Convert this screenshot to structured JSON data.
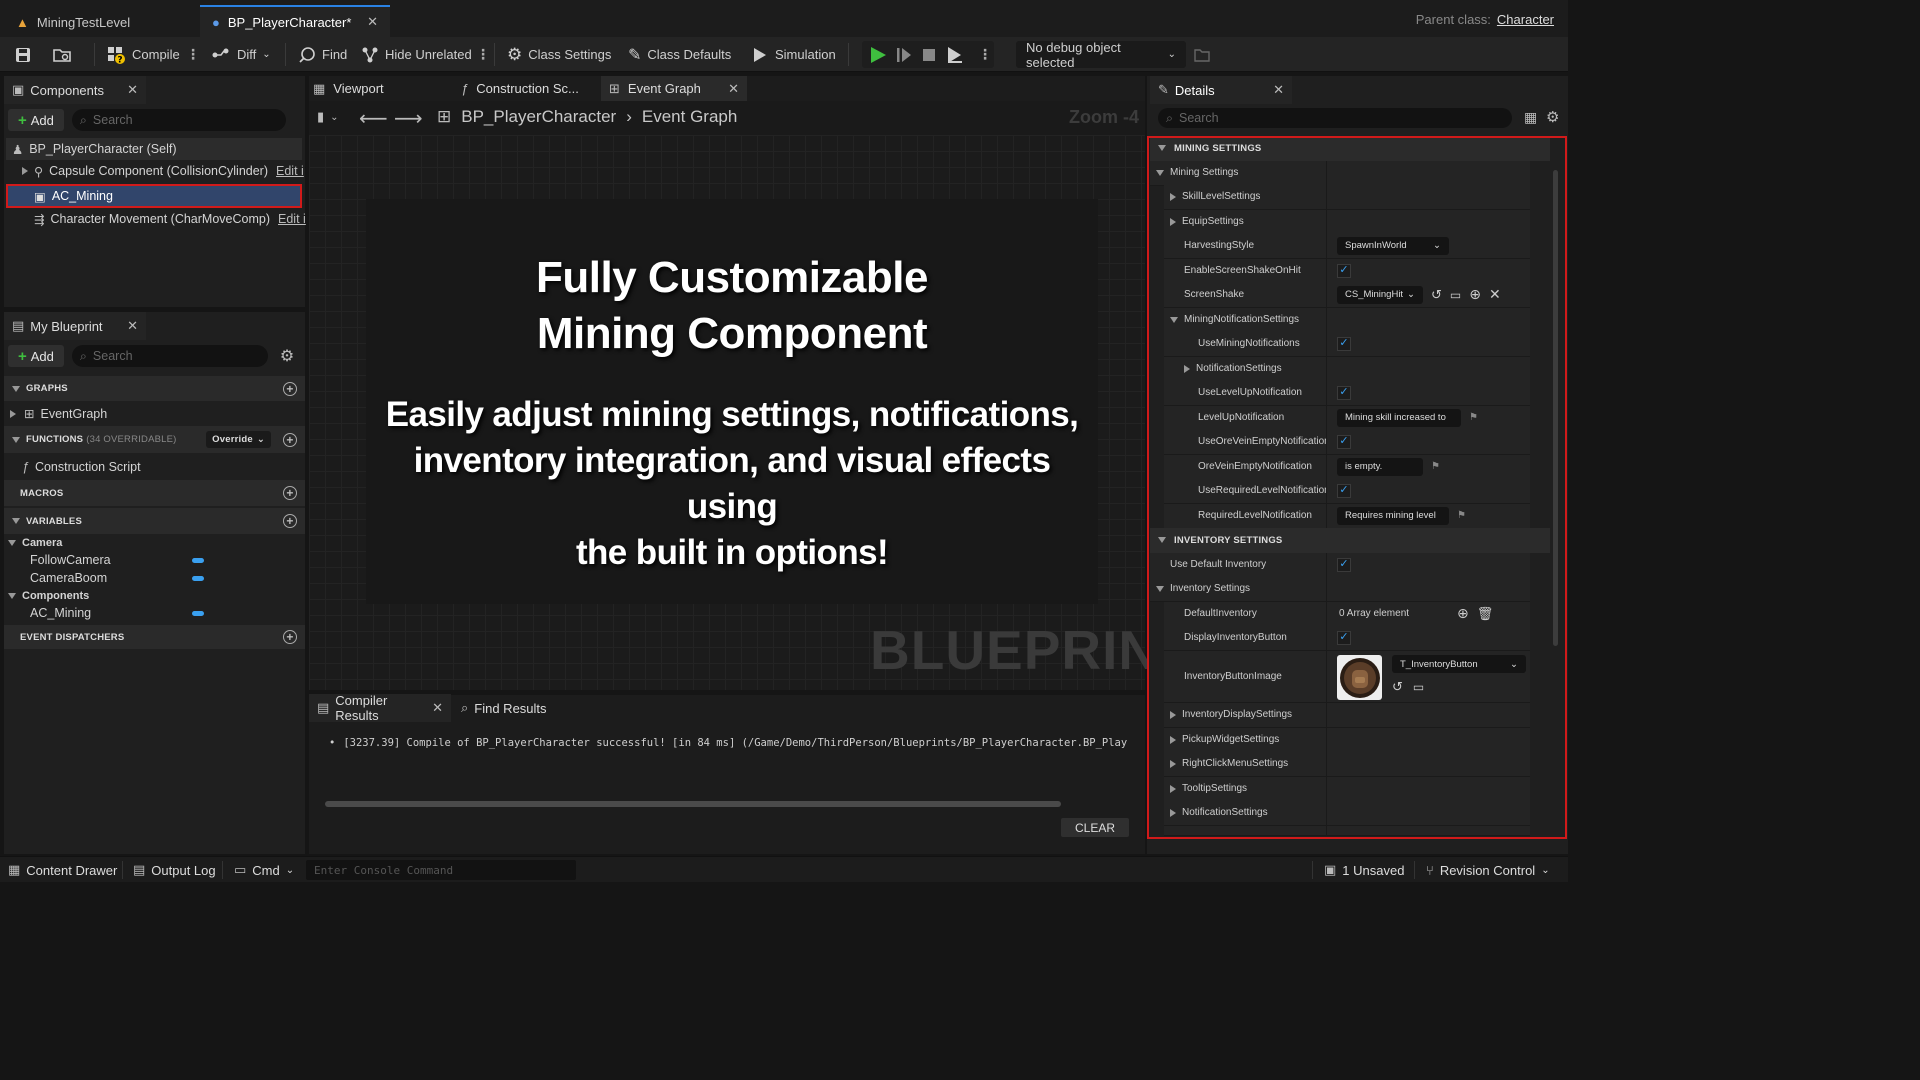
{
  "tabs": [
    {
      "label": "MiningTestLevel"
    },
    {
      "label": "BP_PlayerCharacter*"
    }
  ],
  "parent_class": {
    "label": "Parent class:",
    "value": "Character"
  },
  "toolbar": {
    "compile": "Compile",
    "diff": "Diff",
    "find": "Find",
    "hide_unrelated": "Hide Unrelated",
    "class_settings": "Class Settings",
    "class_defaults": "Class Defaults",
    "simulation": "Simulation",
    "debug_object": "No debug object selected"
  },
  "components": {
    "tab": "Components",
    "add": "Add",
    "search_placeholder": "Search",
    "items": [
      "BP_PlayerCharacter (Self)",
      "Capsule Component (CollisionCylinder)",
      "AC_Mining",
      "Character Movement (CharMoveComp)"
    ],
    "edit_label": "Edit i"
  },
  "my_blueprint": {
    "tab": "My Blueprint",
    "add": "Add",
    "search_placeholder": "Search",
    "graphs": "GRAPHS",
    "event_graph": "EventGraph",
    "functions": "FUNCTIONS",
    "functions_sub": "(34 OVERRIDABLE)",
    "override": "Override",
    "construction_script": "Construction Script",
    "macros": "MACROS",
    "variables": "VARIABLES",
    "cat_camera": "Camera",
    "var_follow": "FollowCamera",
    "var_boom": "CameraBoom",
    "cat_components": "Components",
    "var_mining": "AC_Mining",
    "event_dispatchers": "EVENT DISPATCHERS"
  },
  "graph_tabs": {
    "viewport": "Viewport",
    "construction": "Construction Sc...",
    "event_graph": "Event Graph"
  },
  "breadcrumb": {
    "root": "BP_PlayerCharacter",
    "leaf": "Event Graph",
    "zoom": "Zoom -4"
  },
  "overlay": {
    "title1": "Fully Customizable",
    "title2": "Mining Component",
    "body1": "Easily adjust mining settings, notifications,",
    "body2": "inventory integration, and visual effects using",
    "body3": "the built in options!"
  },
  "watermark": "BLUEPRINT",
  "compiler": {
    "tab": "Compiler Results",
    "find_tab": "Find Results",
    "message": "[3237.39] Compile of BP_PlayerCharacter successful! [in 84 ms] (/Game/Demo/ThirdPerson/Blueprints/BP_PlayerCharacter.BP_Play",
    "clear": "CLEAR"
  },
  "details": {
    "tab": "Details",
    "search_placeholder": "Search",
    "sec_mining": "MINING SETTINGS",
    "mining_settings": "Mining Settings",
    "skill_level": "SkillLevelSettings",
    "equip": "EquipSettings",
    "harvesting_style": "HarvestingStyle",
    "harvesting_value": "SpawnInWorld",
    "enable_shake": "EnableScreenShakeOnHit",
    "screen_shake": "ScreenShake",
    "screen_shake_value": "CS_MiningHit",
    "notif_settings": "MiningNotificationSettings",
    "use_mining_notif": "UseMiningNotifications",
    "notification_settings": "NotificationSettings",
    "use_levelup": "UseLevelUpNotification",
    "levelup": "LevelUpNotification",
    "levelup_value": "Mining skill increased to",
    "use_orevein": "UseOreVeinEmptyNotification",
    "orevein": "OreVeinEmptyNotification",
    "orevein_value": "is empty.",
    "use_required": "UseRequiredLevelNotification",
    "required": "RequiredLevelNotification",
    "required_value": "Requires mining level",
    "sec_inventory": "INVENTORY SETTINGS",
    "use_default_inv": "Use Default Inventory",
    "inventory_settings": "Inventory Settings",
    "default_inv": "DefaultInventory",
    "default_inv_value": "0 Array element",
    "display_inv_btn": "DisplayInventoryButton",
    "inv_btn_image": "InventoryButtonImage",
    "inv_btn_image_value": "T_InventoryButton",
    "inv_display": "InventoryDisplaySettings",
    "pickup_widget": "PickupWidgetSettings",
    "right_click": "RightClickMenuSettings",
    "tooltip": "TooltipSettings",
    "notif_settings2": "NotificationSettings"
  },
  "statusbar": {
    "content_drawer": "Content Drawer",
    "output_log": "Output Log",
    "cmd": "Cmd",
    "console_placeholder": "Enter Console Command",
    "unsaved": "1 Unsaved",
    "revision": "Revision Control"
  },
  "colors": {
    "highlight": "#d11a1a",
    "accent": "#2a82e4",
    "check": "#3aa0f0",
    "play": "#3fbf3f"
  }
}
